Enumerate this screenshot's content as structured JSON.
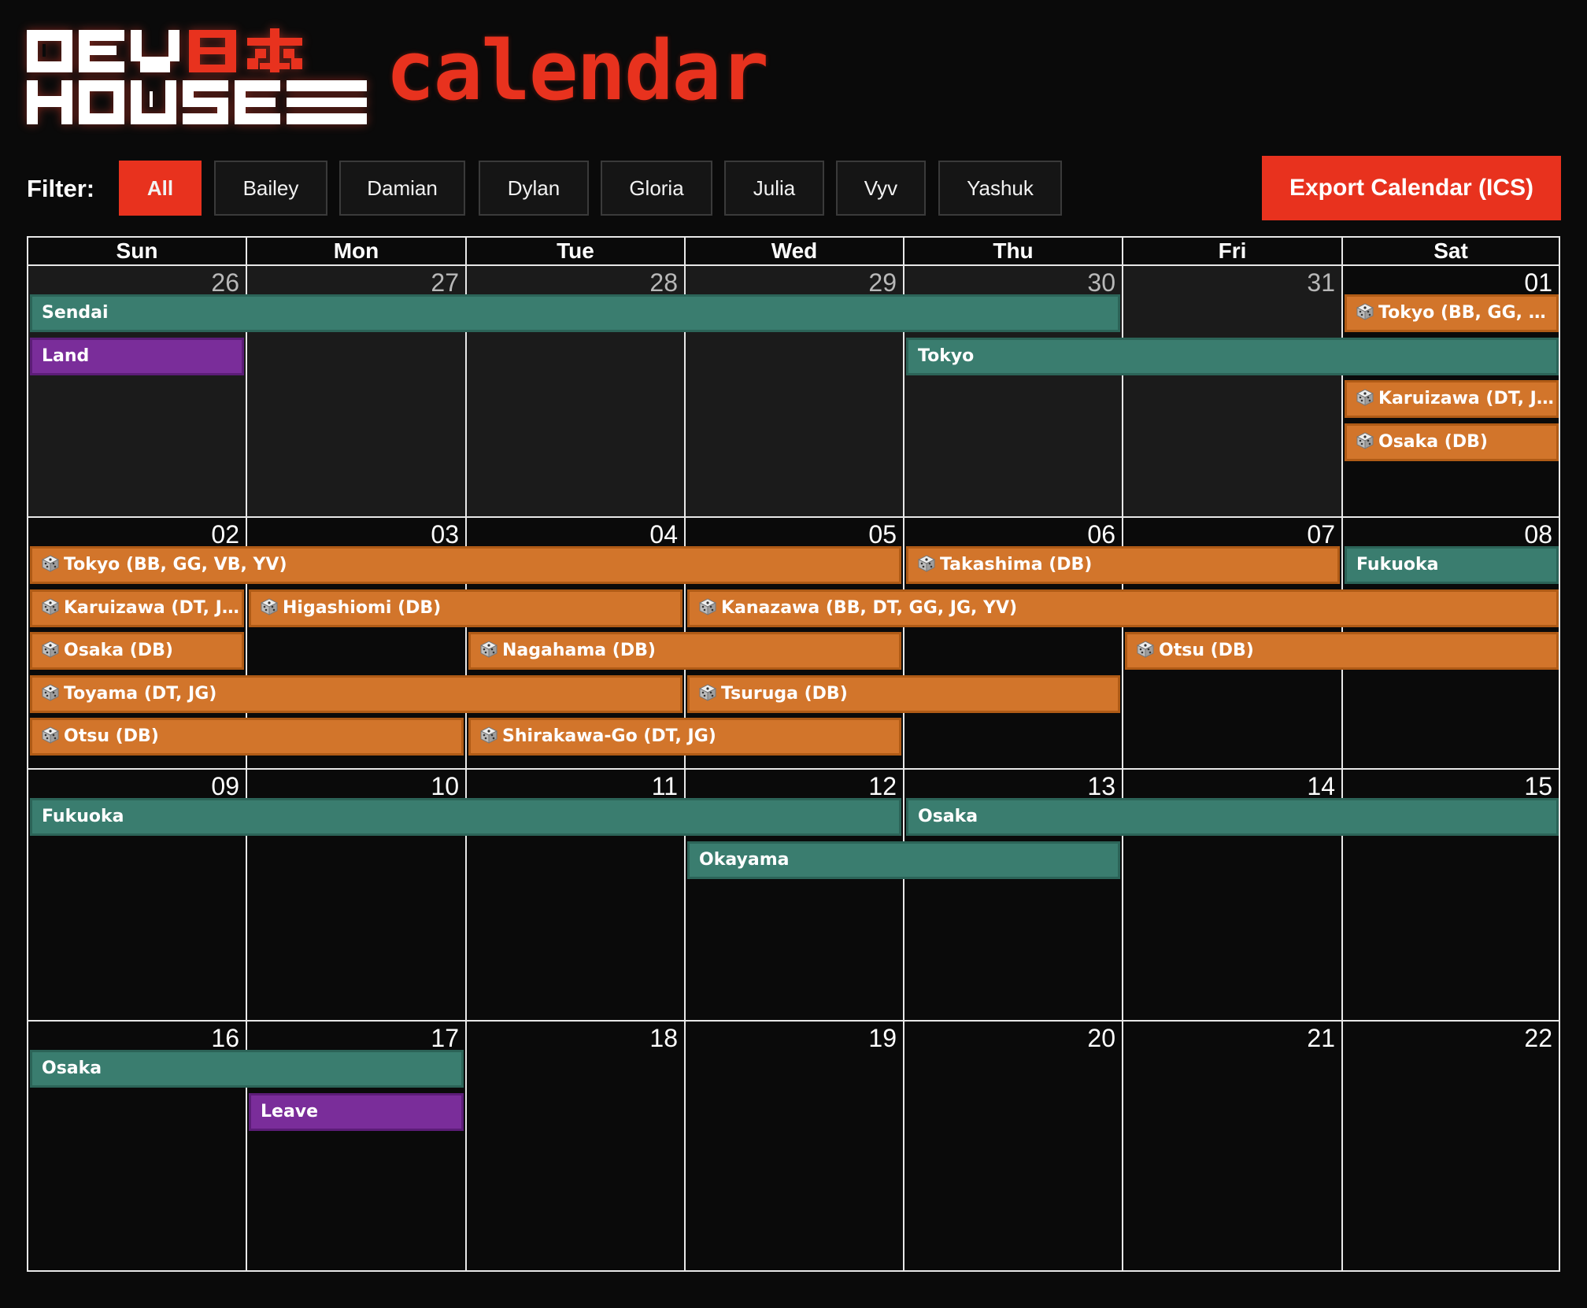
{
  "header": {
    "logo_text_top": "DEV",
    "logo_kanji": "日本",
    "logo_text_bottom": "HOUSE",
    "title": "calendar"
  },
  "filter": {
    "label": "Filter:",
    "buttons": [
      {
        "label": "All",
        "active": true
      },
      {
        "label": "Bailey",
        "active": false
      },
      {
        "label": "Damian",
        "active": false
      },
      {
        "label": "Dylan",
        "active": false
      },
      {
        "label": "Gloria",
        "active": false
      },
      {
        "label": "Julia",
        "active": false
      },
      {
        "label": "Vyv",
        "active": false
      },
      {
        "label": "Yashuk",
        "active": false
      }
    ],
    "export_label": "Export Calendar (ICS)"
  },
  "colors": {
    "accent": "#e8321e",
    "teal": "#3a7d6f",
    "orange": "#d2752b",
    "purple": "#7a2d9a"
  },
  "calendar": {
    "weekdays": [
      "Sun",
      "Mon",
      "Tue",
      "Wed",
      "Thu",
      "Fri",
      "Sat"
    ],
    "weeks": [
      {
        "days": [
          "26",
          "27",
          "28",
          "29",
          "30",
          "31",
          "01"
        ],
        "outside": [
          true,
          true,
          true,
          true,
          true,
          true,
          false
        ],
        "events": [
          {
            "label": "Sendai",
            "type": "teal",
            "start": 0,
            "span": 5,
            "row": 0
          },
          {
            "label": "Tokyo (BB, GG, V...",
            "type": "orange",
            "start": 6,
            "span": 1,
            "row": 0,
            "icon": "dice-icon"
          },
          {
            "label": "Land",
            "type": "purple",
            "start": 0,
            "span": 1,
            "row": 1
          },
          {
            "label": "Tokyo",
            "type": "teal",
            "start": 4,
            "span": 3,
            "row": 1
          },
          {
            "label": "Karuizawa (DT, JG)",
            "type": "orange",
            "start": 6,
            "span": 1,
            "row": 2,
            "icon": "dice-icon"
          },
          {
            "label": "Osaka (DB)",
            "type": "orange",
            "start": 6,
            "span": 1,
            "row": 3,
            "icon": "dice-icon"
          }
        ]
      },
      {
        "days": [
          "02",
          "03",
          "04",
          "05",
          "06",
          "07",
          "08"
        ],
        "outside": [
          false,
          false,
          false,
          false,
          false,
          false,
          false
        ],
        "events": [
          {
            "label": "Tokyo (BB, GG, VB, YV)",
            "type": "orange",
            "start": 0,
            "span": 4,
            "row": 0,
            "icon": "dice-icon"
          },
          {
            "label": "Takashima (DB)",
            "type": "orange",
            "start": 4,
            "span": 2,
            "row": 0,
            "icon": "dice-icon"
          },
          {
            "label": "Fukuoka",
            "type": "teal",
            "start": 6,
            "span": 1,
            "row": 0
          },
          {
            "label": "Karuizawa (DT, JG)",
            "type": "orange",
            "start": 0,
            "span": 1,
            "row": 1,
            "icon": "dice-icon"
          },
          {
            "label": "Higashiomi (DB)",
            "type": "orange",
            "start": 1,
            "span": 2,
            "row": 1,
            "icon": "dice-icon"
          },
          {
            "label": "Kanazawa (BB, DT, GG, JG, YV)",
            "type": "orange",
            "start": 3,
            "span": 4,
            "row": 1,
            "icon": "dice-icon"
          },
          {
            "label": "Osaka (DB)",
            "type": "orange",
            "start": 0,
            "span": 1,
            "row": 2,
            "icon": "dice-icon"
          },
          {
            "label": "Nagahama (DB)",
            "type": "orange",
            "start": 2,
            "span": 2,
            "row": 2,
            "icon": "dice-icon"
          },
          {
            "label": "Otsu (DB)",
            "type": "orange",
            "start": 5,
            "span": 2,
            "row": 2,
            "icon": "dice-icon"
          },
          {
            "label": "Toyama (DT, JG)",
            "type": "orange",
            "start": 0,
            "span": 3,
            "row": 3,
            "icon": "dice-icon"
          },
          {
            "label": "Tsuruga (DB)",
            "type": "orange",
            "start": 3,
            "span": 2,
            "row": 3,
            "icon": "dice-icon"
          },
          {
            "label": "Otsu (DB)",
            "type": "orange",
            "start": 0,
            "span": 2,
            "row": 4,
            "icon": "dice-icon"
          },
          {
            "label": "Shirakawa-Go (DT, JG)",
            "type": "orange",
            "start": 2,
            "span": 2,
            "row": 4,
            "icon": "dice-icon"
          }
        ]
      },
      {
        "days": [
          "09",
          "10",
          "11",
          "12",
          "13",
          "14",
          "15"
        ],
        "outside": [
          false,
          false,
          false,
          false,
          false,
          false,
          false
        ],
        "events": [
          {
            "label": "Fukuoka",
            "type": "teal",
            "start": 0,
            "span": 4,
            "row": 0
          },
          {
            "label": "Osaka",
            "type": "teal",
            "start": 4,
            "span": 3,
            "row": 0
          },
          {
            "label": "Okayama",
            "type": "teal",
            "start": 3,
            "span": 2,
            "row": 1
          }
        ]
      },
      {
        "days": [
          "16",
          "17",
          "18",
          "19",
          "20",
          "21",
          "22"
        ],
        "outside": [
          false,
          false,
          false,
          false,
          false,
          false,
          false
        ],
        "events": [
          {
            "label": "Osaka",
            "type": "teal",
            "start": 0,
            "span": 2,
            "row": 0
          },
          {
            "label": "Leave",
            "type": "purple",
            "start": 1,
            "span": 1,
            "row": 1
          }
        ]
      }
    ]
  }
}
